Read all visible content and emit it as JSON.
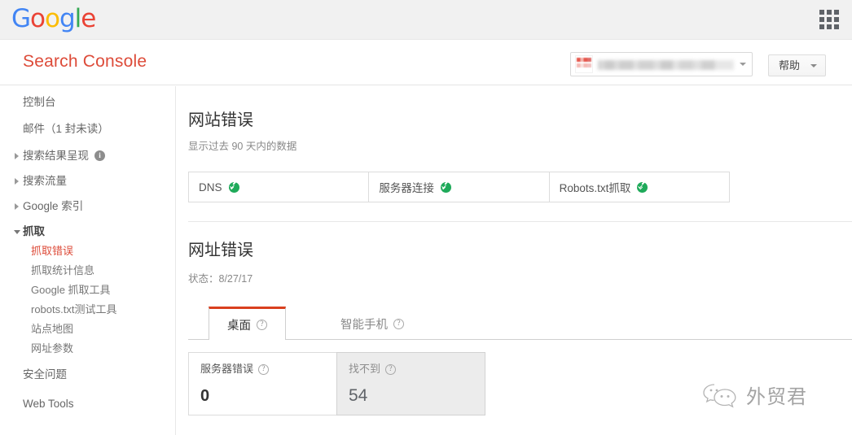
{
  "topbar": {
    "logo": {
      "letters": [
        "G",
        "o",
        "o",
        "g",
        "l",
        "e"
      ],
      "colors": [
        "#4285f4",
        "#ea4335",
        "#fbbc05",
        "#4285f4",
        "#34a853",
        "#ea4335"
      ]
    },
    "apps_icon": "apps-grid-icon"
  },
  "header": {
    "product_title": "Search Console",
    "property_selector": {
      "value": "",
      "caret": "▾"
    },
    "help_button": {
      "label": "帮助",
      "caret": "▾"
    }
  },
  "sidebar": {
    "items": [
      {
        "label": "控制台",
        "type": "link"
      },
      {
        "label": "邮件（1 封未读）",
        "type": "link"
      },
      {
        "label": "搜索结果呈现",
        "type": "group",
        "expanded": false,
        "info": "i"
      },
      {
        "label": "搜索流量",
        "type": "group",
        "expanded": false
      },
      {
        "label": "Google 索引",
        "type": "group",
        "expanded": false
      },
      {
        "label": "抓取",
        "type": "group",
        "expanded": true
      }
    ],
    "crawl_children": [
      {
        "label": "抓取错误",
        "active": true
      },
      {
        "label": "抓取统计信息",
        "active": false
      },
      {
        "label": "Google 抓取工具",
        "active": false
      },
      {
        "label": "robots.txt测试工具",
        "active": false
      },
      {
        "label": "站点地图",
        "active": false
      },
      {
        "label": "网址参数",
        "active": false
      }
    ],
    "bottom_items": [
      {
        "label": "安全问题"
      },
      {
        "label": "Web Tools"
      }
    ]
  },
  "main": {
    "site_errors": {
      "title": "网站错误",
      "subtitle": "显示过去 90 天内的数据",
      "cells": [
        {
          "label": "DNS",
          "status": "ok"
        },
        {
          "label": "服务器连接",
          "status": "ok"
        },
        {
          "label": "Robots.txt抓取",
          "status": "ok"
        }
      ]
    },
    "url_errors": {
      "title": "网址错误",
      "subtitle": "状态：8/27/17",
      "tabs": [
        {
          "label": "桌面",
          "help": "?",
          "active": true
        },
        {
          "label": "智能手机",
          "help": "?",
          "active": false
        }
      ],
      "cards": [
        {
          "label": "服务器错误",
          "help": "?",
          "value": "0",
          "selected": false
        },
        {
          "label": "找不到",
          "help": "?",
          "value": "54",
          "selected": true
        }
      ]
    }
  },
  "watermark": {
    "text": "外贸君",
    "icon": "wechat-bubbles-icon"
  },
  "colors": {
    "brand_red": "#dd4b39",
    "tab_accent": "#d93f1e",
    "status_green": "#1faa5a",
    "topbar_bg": "#f1f1f1"
  }
}
